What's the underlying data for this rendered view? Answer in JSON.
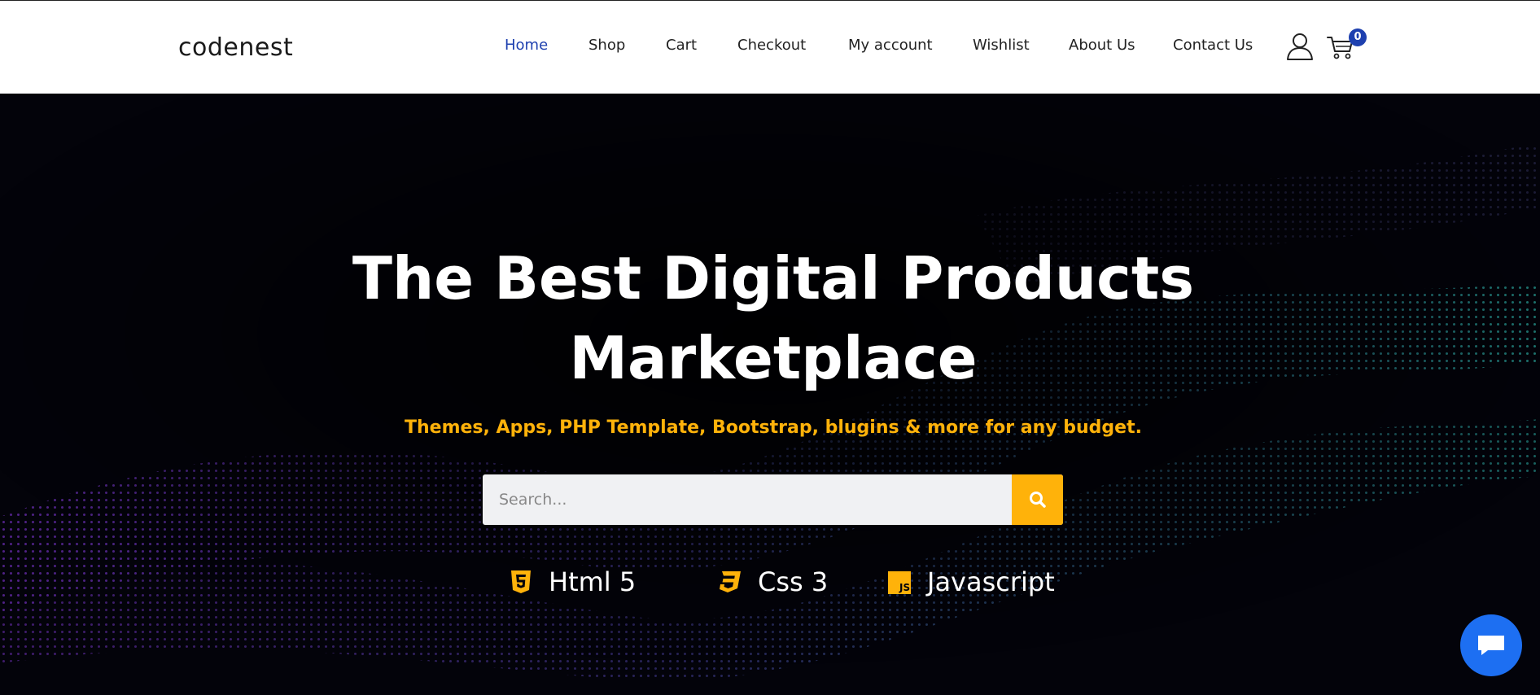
{
  "brand": {
    "logo": "codenest"
  },
  "nav": {
    "items": [
      {
        "label": "Home",
        "active": true
      },
      {
        "label": "Shop",
        "active": false
      },
      {
        "label": "Cart",
        "active": false
      },
      {
        "label": "Checkout",
        "active": false
      },
      {
        "label": "My account",
        "active": false
      },
      {
        "label": "Wishlist",
        "active": false
      },
      {
        "label": "About Us",
        "active": false
      },
      {
        "label": "Contact Us",
        "active": false
      }
    ],
    "user_icon": "user-icon",
    "cart_icon": "cart-icon",
    "cart_count": "0"
  },
  "hero": {
    "title_line1": "The Best Digital Products",
    "title_line2": "Marketplace",
    "subtitle": "Themes, Apps, PHP Template, Bootstrap, blugins & more for any budget.",
    "search": {
      "placeholder": "Search...",
      "value": "",
      "button_icon": "search-icon"
    },
    "technologies": [
      {
        "label": "Html 5",
        "icon": "html5-icon"
      },
      {
        "label": "Css 3",
        "icon": "css3-icon"
      },
      {
        "label": "Javascript",
        "icon": "javascript-icon"
      }
    ]
  },
  "chat": {
    "icon": "chat-icon"
  },
  "colors": {
    "accent": "#1e40af",
    "highlight": "#ffb20a",
    "hero_bg": "#03030a",
    "chat_button": "#1d6ff2"
  }
}
